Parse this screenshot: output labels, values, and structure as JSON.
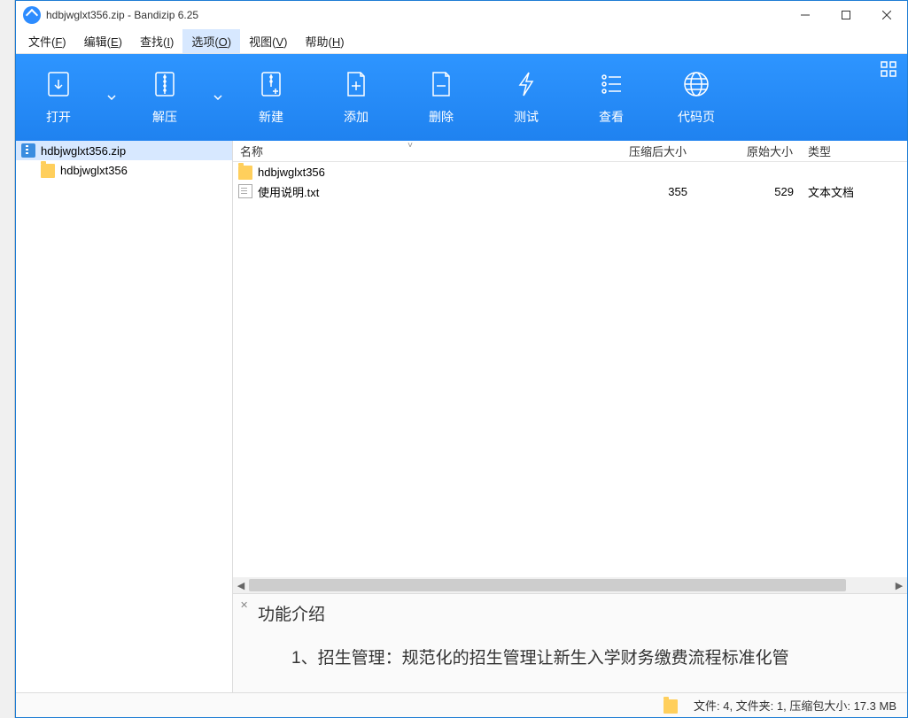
{
  "titlebar": {
    "title": "hdbjwglxt356.zip - Bandizip 6.25"
  },
  "menu": {
    "file": "文件(F)",
    "edit": "编辑(E)",
    "find": "查找(I)",
    "options": "选项(O)",
    "view": "视图(V)",
    "help": "帮助(H)"
  },
  "toolbar": {
    "open": "打开",
    "extract": "解压",
    "new": "新建",
    "add": "添加",
    "delete": "删除",
    "test": "测试",
    "view": "查看",
    "codepage": "代码页"
  },
  "tree": {
    "root": "hdbjwglxt356.zip",
    "child": "hdbjwglxt356"
  },
  "columns": {
    "name": "名称",
    "compressed": "压缩后大小",
    "original": "原始大小",
    "type": "类型"
  },
  "files": [
    {
      "icon": "folder",
      "name": "hdbjwglxt356",
      "compressed": "",
      "original": "",
      "type": ""
    },
    {
      "icon": "txt",
      "name": "使用说明.txt",
      "compressed": "355",
      "original": "529",
      "type": "文本文档"
    }
  ],
  "preview": {
    "title": "功能介绍",
    "body": "1、招生管理：规范化的招生管理让新生入学财务缴费流程标准化管"
  },
  "status": {
    "text": "文件: 4, 文件夹: 1, 压缩包大小: 17.3 MB"
  }
}
